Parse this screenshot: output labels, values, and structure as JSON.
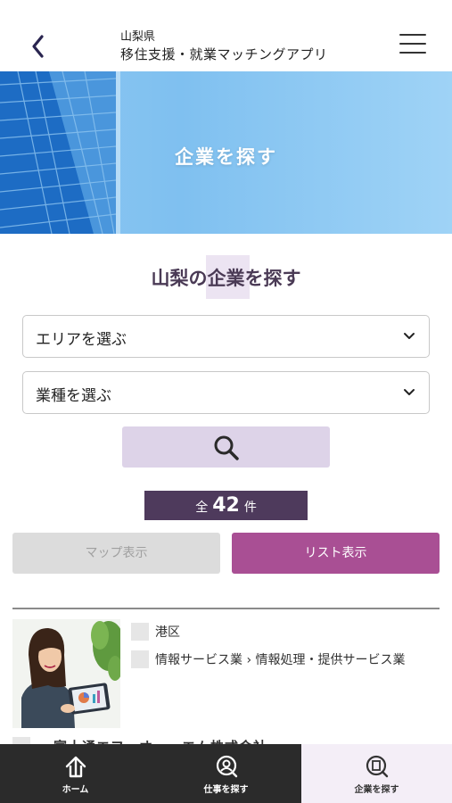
{
  "header": {
    "prefecture": "山梨県",
    "app_title": "移住支援・就業マッチングアプリ",
    "back_icon": "chevron-left-icon",
    "menu_icon": "hamburger-menu-icon"
  },
  "hero": {
    "title": "企業を探す"
  },
  "search": {
    "section_title": "山梨の企業を探す",
    "area_select": "エリアを選ぶ",
    "industry_select": "業種を選ぶ",
    "search_icon": "search-icon"
  },
  "results": {
    "count_prefix": "全",
    "count": "42",
    "count_suffix": "件"
  },
  "view_toggle": {
    "map": "マップ表示",
    "list": "リスト表示",
    "active": "list"
  },
  "listing": {
    "items": [
      {
        "area": "港区",
        "industry": "情報サービス業 › 情報処理・提供サービス業",
        "name": "富士通エフ・オー・エム株式会社"
      }
    ]
  },
  "bottom_nav": {
    "items": [
      {
        "label": "ホーム",
        "icon": "home-icon"
      },
      {
        "label": "仕事を探す",
        "icon": "person-search-icon"
      },
      {
        "label": "企業を探す",
        "icon": "building-search-icon",
        "active": true
      }
    ]
  },
  "colors": {
    "accent": "#a94f94",
    "count_bg": "#4e3a5c",
    "search_btn": "#ddd3e8",
    "nav_bg": "#2b2b2b"
  }
}
